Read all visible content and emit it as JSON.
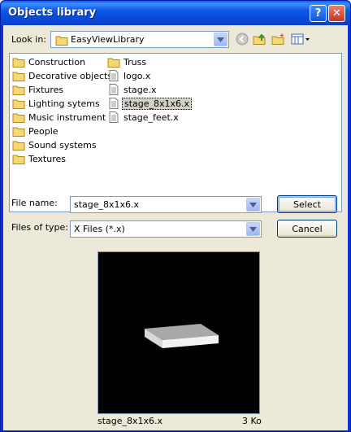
{
  "window": {
    "title": "Objects library",
    "help_glyph": "?",
    "close_glyph": "✕"
  },
  "lookin": {
    "label": "Look in:",
    "value": "EasyViewLibrary"
  },
  "toolbar": {
    "icons": [
      "back-icon",
      "up-folder-icon",
      "new-folder-icon",
      "view-menu-icon"
    ]
  },
  "files": {
    "folders_col1": [
      "Construction",
      "Decorative objects",
      "Fixtures",
      "Lighting sytems",
      "Music instrument",
      "People",
      "Sound systems",
      "Textures"
    ],
    "col2": [
      {
        "name": "Truss",
        "type": "folder"
      },
      {
        "name": "logo.x",
        "type": "file"
      },
      {
        "name": "stage.x",
        "type": "file"
      },
      {
        "name": "stage_8x1x6.x",
        "type": "file",
        "selected": true
      },
      {
        "name": "stage_feet.x",
        "type": "file"
      }
    ]
  },
  "filename": {
    "label": "File name:",
    "value": "stage_8x1x6.x"
  },
  "filetype": {
    "label": "Files of type:",
    "value": "X Files (*.x)"
  },
  "buttons": {
    "select": "Select",
    "cancel": "Cancel"
  },
  "preview": {
    "name": "stage_8x1x6.x",
    "size": "3 Ko"
  },
  "colors": {
    "title_bar": "#0a57e6",
    "dialog_bg": "#ece9d8",
    "folder_yellow": "#f6d873",
    "preview_bg": "#000000"
  }
}
